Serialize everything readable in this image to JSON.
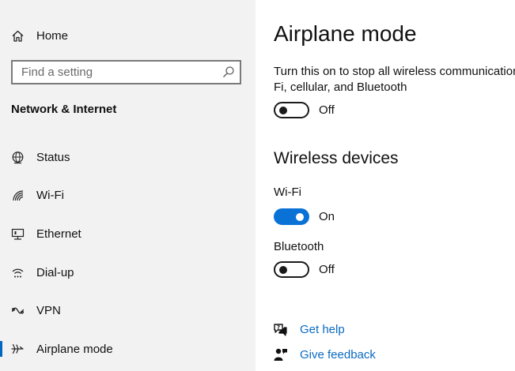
{
  "sidebar": {
    "home": {
      "label": "Home",
      "icon": "home-icon"
    },
    "search": {
      "placeholder": "Find a setting",
      "icon": "search-icon"
    },
    "section_title": "Network & Internet",
    "items": [
      {
        "label": "Status",
        "icon": "globe-icon"
      },
      {
        "label": "Wi-Fi",
        "icon": "wifi-icon"
      },
      {
        "label": "Ethernet",
        "icon": "ethernet-icon"
      },
      {
        "label": "Dial-up",
        "icon": "dialup-icon"
      },
      {
        "label": "VPN",
        "icon": "vpn-icon"
      },
      {
        "label": "Airplane mode",
        "icon": "airplane-icon",
        "selected": true
      }
    ]
  },
  "main": {
    "title": "Airplane mode",
    "description": "Turn this on to stop all wireless communication, such as Wi-Fi, cellular, and Bluetooth",
    "airplane_toggle": {
      "state": "Off",
      "on": false
    },
    "wireless_heading": "Wireless devices",
    "wifi": {
      "label": "Wi-Fi",
      "state": "On",
      "on": true
    },
    "bluetooth": {
      "label": "Bluetooth",
      "state": "Off",
      "on": false
    },
    "links": [
      {
        "label": "Get help",
        "icon": "help-chat-icon"
      },
      {
        "label": "Give feedback",
        "icon": "feedback-icon"
      }
    ]
  },
  "colors": {
    "accent": "#0a72d6",
    "link": "#0b6ac1",
    "sidebar_bg": "#f2f2f2"
  }
}
